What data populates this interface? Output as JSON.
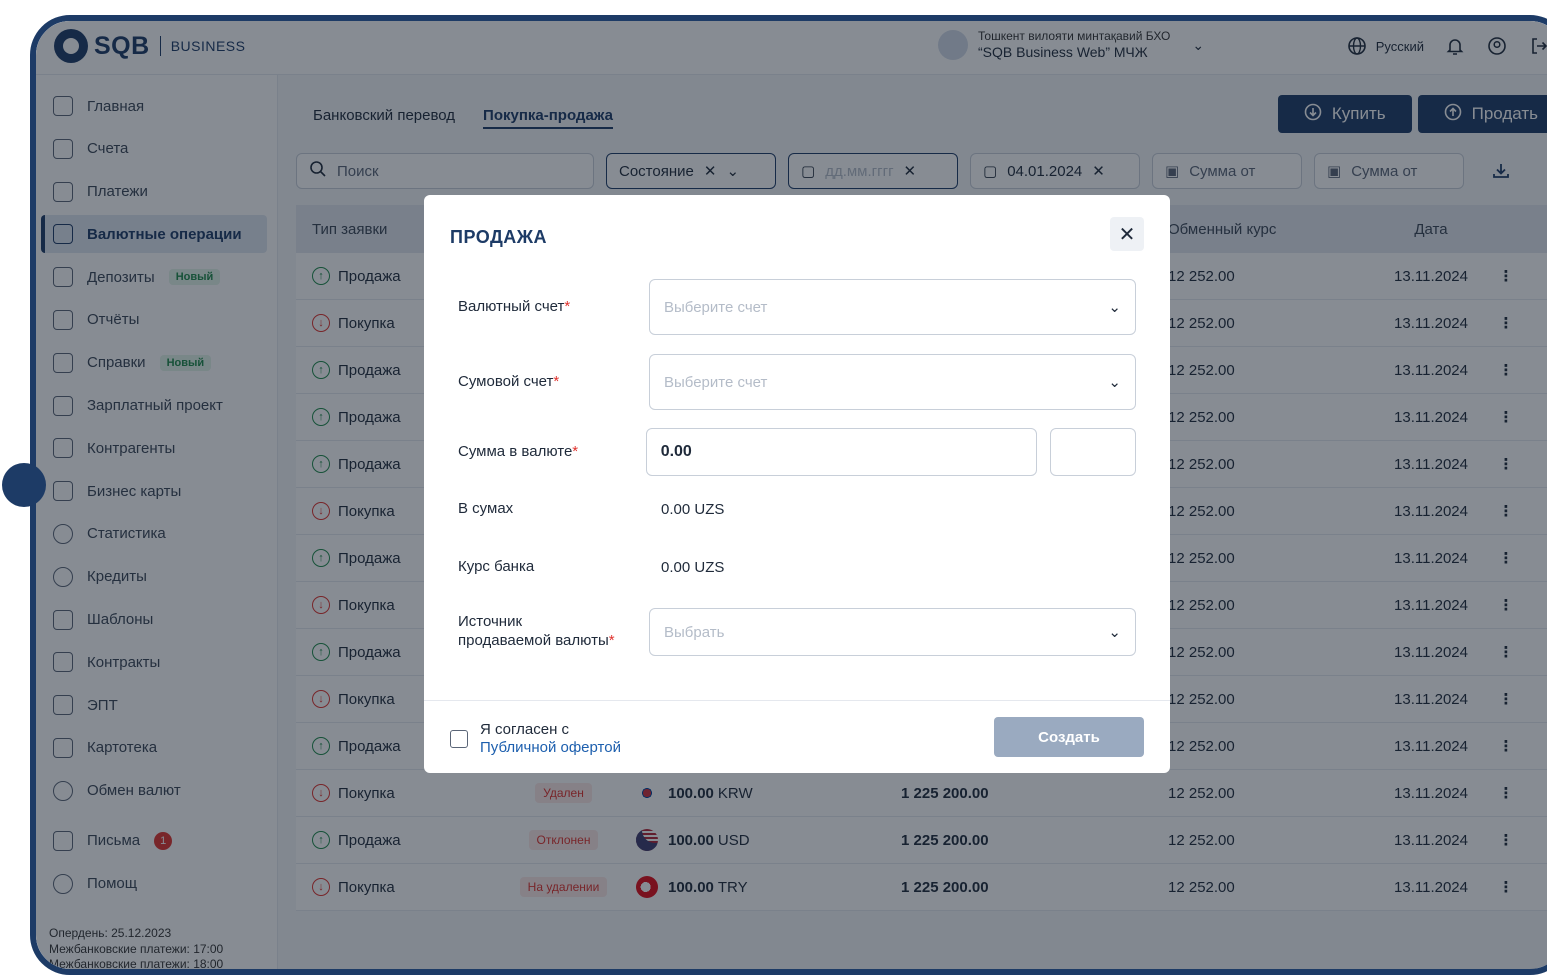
{
  "brand": {
    "name": "SQB",
    "sub": "BUSINESS",
    "color": "#1d3b66"
  },
  "org": {
    "line1": "Тошкент вилояти минтақавий БХО",
    "line2": "“SQB Business Web” МЧЖ"
  },
  "header": {
    "language": "Русский"
  },
  "sidebar": {
    "items": [
      {
        "label": "Главная",
        "icon": "home-icon"
      },
      {
        "label": "Счета",
        "icon": "wallet-icon"
      },
      {
        "label": "Платежи",
        "icon": "payment-icon"
      },
      {
        "label": "Валютные операции",
        "icon": "currency-icon",
        "active": true
      },
      {
        "label": "Депозиты",
        "icon": "bank-icon",
        "badge": "Новый"
      },
      {
        "label": "Отчёты",
        "icon": "report-icon"
      },
      {
        "label": "Справки",
        "icon": "document-icon",
        "badge": "Новый"
      },
      {
        "label": "Зарплатный проект",
        "icon": "payroll-icon"
      },
      {
        "label": "Контрагенты",
        "icon": "contacts-icon"
      },
      {
        "label": "Бизнес карты",
        "icon": "card-icon"
      },
      {
        "label": "Статистика",
        "icon": "pie-chart-icon"
      },
      {
        "label": "Кредиты",
        "icon": "percent-icon"
      },
      {
        "label": "Шаблоны",
        "icon": "template-icon"
      },
      {
        "label": "Контракты",
        "icon": "contract-icon"
      },
      {
        "label": "ЭПТ",
        "icon": "file-icon"
      },
      {
        "label": "Картотека",
        "icon": "folder-icon"
      },
      {
        "label": "Обмен валют",
        "icon": "euro-icon"
      },
      {
        "label": "Письма",
        "icon": "mail-icon",
        "count": "1"
      },
      {
        "label": "Помощ",
        "icon": "help-icon"
      }
    ],
    "footer_l1": "Опердень: 25.12.2023",
    "footer_l2": "Межбанковские платежи: 17:00",
    "footer_l3": "Межбанковские платежи: 18:00"
  },
  "tabs": {
    "transfer": "Банковский перевод",
    "trade": "Покупка-продажа"
  },
  "actions": {
    "buy": "Купить",
    "sell": "Продать"
  },
  "filters": {
    "search_placeholder": "Поиск",
    "status": "Состояние",
    "date_from_placeholder": "дд.мм.гггг",
    "date_to": "04.01.2024",
    "amount_from": "Сумма от",
    "amount_to": "Сумма от"
  },
  "table": {
    "headers": {
      "type": "Тип заявки",
      "rate": "Обменный курс",
      "date": "Дата"
    },
    "rows": [
      {
        "type": "Продажа",
        "dir": "sell",
        "rate": "12 252.00",
        "date": "13.11.2024"
      },
      {
        "type": "Покупка",
        "dir": "buy",
        "rate": "12 252.00",
        "date": "13.11.2024"
      },
      {
        "type": "Продажа",
        "dir": "sell",
        "rate": "12 252.00",
        "date": "13.11.2024"
      },
      {
        "type": "Продажа",
        "dir": "sell",
        "rate": "12 252.00",
        "date": "13.11.2024"
      },
      {
        "type": "Продажа",
        "dir": "sell",
        "rate": "12 252.00",
        "date": "13.11.2024"
      },
      {
        "type": "Покупка",
        "dir": "buy",
        "rate": "12 252.00",
        "date": "13.11.2024"
      },
      {
        "type": "Продажа",
        "dir": "sell",
        "rate": "12 252.00",
        "date": "13.11.2024"
      },
      {
        "type": "Покупка",
        "dir": "buy",
        "rate": "12 252.00",
        "date": "13.11.2024"
      },
      {
        "type": "Продажа",
        "dir": "sell",
        "rate": "12 252.00",
        "date": "13.11.2024"
      },
      {
        "type": "Покупка",
        "dir": "buy",
        "rate": "12 252.00",
        "date": "13.11.2024"
      },
      {
        "type": "Продажа",
        "dir": "sell",
        "rate": "12 252.00",
        "date": "13.11.2024"
      },
      {
        "type": "Покупка",
        "dir": "buy",
        "status": "Удален",
        "amount": "100.00",
        "currency": "KRW",
        "flag": "kr",
        "sum": "1 225 200.00",
        "rate": "12 252.00",
        "date": "13.11.2024"
      },
      {
        "type": "Продажа",
        "dir": "sell",
        "status": "Отклонен",
        "amount": "100.00",
        "currency": "USD",
        "flag": "us",
        "sum": "1 225 200.00",
        "rate": "12 252.00",
        "date": "13.11.2024"
      },
      {
        "type": "Покупка",
        "dir": "buy",
        "status": "На удалении",
        "amount": "100.00",
        "currency": "TRY",
        "flag": "tr",
        "sum": "1 225 200.00",
        "rate": "12 252.00",
        "date": "13.11.2024"
      }
    ]
  },
  "modal": {
    "title": "ПРОДАЖА",
    "currency_account_label": "Валютный счет",
    "currency_account_placeholder": "Выберите счет",
    "sum_account_label": "Сумовой счет",
    "sum_account_placeholder": "Выберите счет",
    "amount_label": "Сумма в валюте",
    "amount_value": "0.00",
    "in_sum_label": "В сумах",
    "in_sum_value": "0.00 UZS",
    "rate_label": "Курс банка",
    "rate_value": "0.00 UZS",
    "source_label_l1": "Источник",
    "source_label_l2": "продаваемой валюты",
    "source_placeholder": "Выбрать",
    "consent_text": "Я согласен с",
    "consent_link": "Публичной офертой",
    "create": "Создать"
  }
}
